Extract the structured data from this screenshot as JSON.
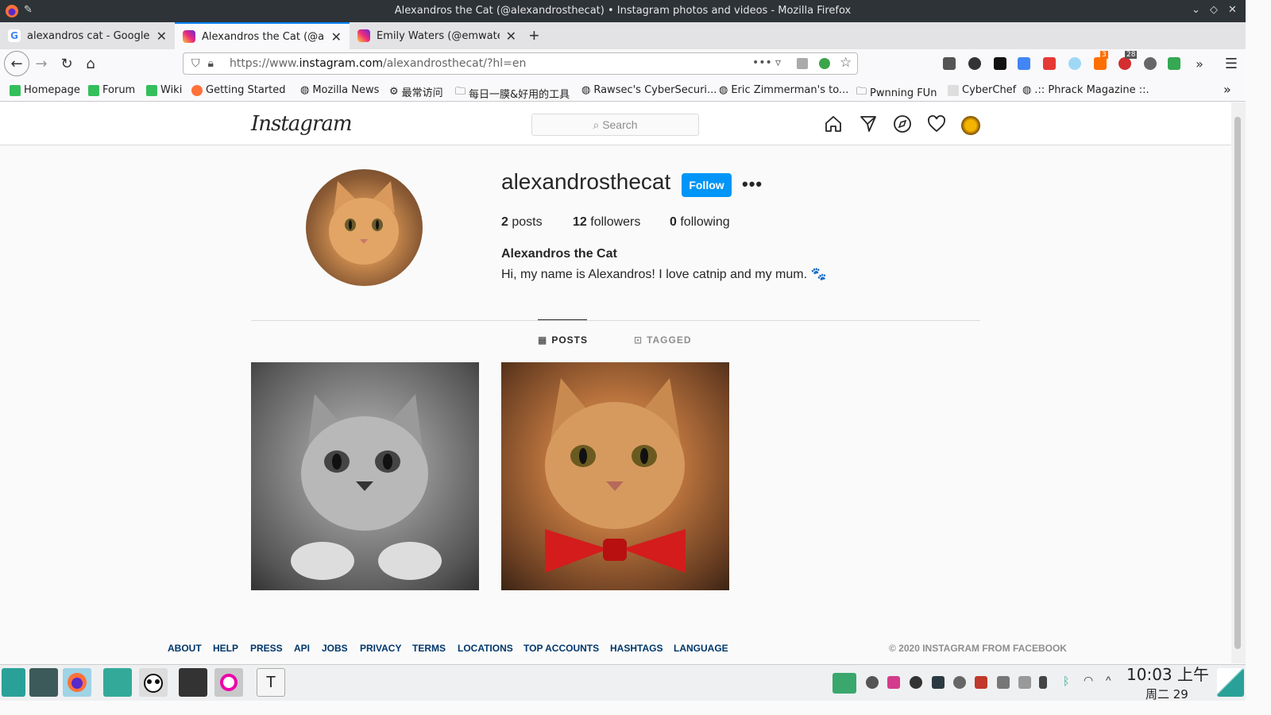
{
  "window": {
    "title": "Alexandros the Cat (@alexandrosthecat) • Instagram photos and videos - Mozilla Firefox"
  },
  "tabs": [
    {
      "title": "alexandros cat - Google Se",
      "icon": "google-icon"
    },
    {
      "title": "Alexandros the Cat (@alex",
      "icon": "instagram-icon"
    },
    {
      "title": "Emily Waters (@emwaters",
      "icon": "instagram-icon"
    }
  ],
  "urlbar": {
    "prefix": "https://www.",
    "domain": "instagram.com",
    "path": "/alexandrosthecat/?hl=en",
    "more": "•••"
  },
  "bookmarks": [
    "Homepage",
    "Forum",
    "Wiki",
    "Getting Started",
    "Mozilla News",
    "最常访问",
    "每日一膜&好用的工具",
    "Rawsec's CyberSecuri...",
    "Eric Zimmerman's to...",
    "Pwnning FUn",
    "CyberChef",
    ".:: Phrack Magazine ::."
  ],
  "ext_badges": {
    "first": "3",
    "second": "28"
  },
  "instagram": {
    "logo": "Instagram",
    "search_placeholder": "Search",
    "profile": {
      "username": "alexandrosthecat",
      "follow_label": "Follow",
      "more": "•••",
      "posts_count": "2",
      "posts_label": "posts",
      "followers_count": "12",
      "followers_label": "followers",
      "following_count": "0",
      "following_label": "following",
      "full_name": "Alexandros the Cat",
      "bio": "Hi, my name is Alexandros! I love catnip and my mum. 🐾"
    },
    "tabs": {
      "posts": "POSTS",
      "tagged": "TAGGED"
    },
    "footer": [
      "ABOUT",
      "HELP",
      "PRESS",
      "API",
      "JOBS",
      "PRIVACY",
      "TERMS",
      "LOCATIONS",
      "TOP ACCOUNTS",
      "HASHTAGS",
      "LANGUAGE"
    ],
    "copyright": "© 2020 INSTAGRAM FROM FACEBOOK"
  },
  "taskbar": {
    "time": "10:03 上午",
    "date": "周二 29"
  },
  "colors": {
    "follow": "#0095f6",
    "link": "#00376b",
    "tab_accent": "#0a84ff"
  }
}
